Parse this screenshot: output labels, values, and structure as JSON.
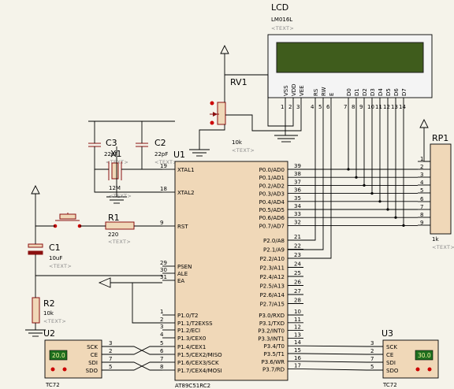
{
  "lcd": {
    "ref": "LCD",
    "model": "LM016L",
    "placeholder": "<TEXT>",
    "pins": [
      {
        "name": "VSS",
        "num": "1"
      },
      {
        "name": "VDD",
        "num": "2"
      },
      {
        "name": "VEE",
        "num": "3"
      },
      {
        "name": "RS",
        "num": "4"
      },
      {
        "name": "RW",
        "num": "5"
      },
      {
        "name": "E",
        "num": "6"
      },
      {
        "name": "D0",
        "num": "7"
      },
      {
        "name": "D1",
        "num": "8"
      },
      {
        "name": "D2",
        "num": "9"
      },
      {
        "name": "D3",
        "num": "10"
      },
      {
        "name": "D4",
        "num": "11"
      },
      {
        "name": "D5",
        "num": "12"
      },
      {
        "name": "D6",
        "num": "13"
      },
      {
        "name": "D7",
        "num": "14"
      }
    ],
    "screen_color": "#3f5c1c"
  },
  "rv1": {
    "ref": "RV1",
    "value": "10k",
    "placeholder": "<TEXT>"
  },
  "c3": {
    "ref": "C3",
    "value": "22pF",
    "placeholder": "<TEXT>"
  },
  "c2": {
    "ref": "C2",
    "value": "22pF",
    "placeholder": "<TEXT>"
  },
  "x1": {
    "ref": "X1",
    "value": "12M",
    "placeholder": "<TEXT>"
  },
  "r1": {
    "ref": "R1",
    "value": "220",
    "placeholder": "<TEXT>"
  },
  "c1": {
    "ref": "C1",
    "value": "10uF",
    "placeholder": "<TEXT>"
  },
  "r2": {
    "ref": "R2",
    "value": "10k",
    "placeholder": "<TEXT>"
  },
  "rp1": {
    "ref": "RP1",
    "value": "1k",
    "placeholder": "<TEXT>",
    "pins": [
      "1",
      "2",
      "3",
      "4",
      "5",
      "6",
      "7",
      "8",
      "9"
    ]
  },
  "u1": {
    "ref": "U1",
    "model": "AT89C51RC2",
    "left_pins": [
      {
        "name": "XTAL1",
        "num": "19"
      },
      {
        "name": "XTAL2",
        "num": "18"
      },
      {
        "name": "RST",
        "num": "9"
      },
      {
        "name": "PSEN",
        "num": "29"
      },
      {
        "name": "ALE",
        "num": "30"
      },
      {
        "name": "EA",
        "num": "31"
      },
      {
        "name": "P1.0/T2",
        "num": "1"
      },
      {
        "name": "P1.1/T2EXSS",
        "num": "2"
      },
      {
        "name": "P1.2/ECI",
        "num": "3"
      },
      {
        "name": "P1.3/CEX0",
        "num": "4"
      },
      {
        "name": "P1.4/CEX1",
        "num": "5"
      },
      {
        "name": "P1.5/CEX2/MISO",
        "num": "6"
      },
      {
        "name": "P1.6/CEX3/SCK",
        "num": "7"
      },
      {
        "name": "P1.7/CEX4/MOSI",
        "num": "8"
      }
    ],
    "right_pins": [
      {
        "name": "P0.0/AD0",
        "num": "39"
      },
      {
        "name": "P0.1/AD1",
        "num": "38"
      },
      {
        "name": "P0.2/AD2",
        "num": "37"
      },
      {
        "name": "P0.3/AD3",
        "num": "36"
      },
      {
        "name": "P0.4/AD4",
        "num": "35"
      },
      {
        "name": "P0.5/AD5",
        "num": "34"
      },
      {
        "name": "P0.6/AD6",
        "num": "33"
      },
      {
        "name": "P0.7/AD7",
        "num": "32"
      },
      {
        "name": "P2.0/A8",
        "num": "21"
      },
      {
        "name": "P2.1/A9",
        "num": "22"
      },
      {
        "name": "P2.2/A10",
        "num": "23"
      },
      {
        "name": "P2.3/A11",
        "num": "24"
      },
      {
        "name": "P2.4/A12",
        "num": "25"
      },
      {
        "name": "P2.5/A13",
        "num": "26"
      },
      {
        "name": "P2.6/A14",
        "num": "27"
      },
      {
        "name": "P2.7/A15",
        "num": "28"
      },
      {
        "name": "P3.0/RXD",
        "num": "10"
      },
      {
        "name": "P3.1/TXD",
        "num": "11"
      },
      {
        "name": "P3.2/INT0",
        "num": "12"
      },
      {
        "name": "P3.3/INT1",
        "num": "13"
      },
      {
        "name": "P3.4/T0",
        "num": "14"
      },
      {
        "name": "P3.5/T1",
        "num": "15"
      },
      {
        "name": "P3.6/WR",
        "num": "16"
      },
      {
        "name": "P3.7/RD",
        "num": "17"
      }
    ]
  },
  "u2": {
    "ref": "U2",
    "model": "TC72",
    "display": "20.0",
    "pins": [
      {
        "name": "SCK",
        "num": "3"
      },
      {
        "name": "CE",
        "num": "2"
      },
      {
        "name": "SDI",
        "num": "7"
      },
      {
        "name": "SDO",
        "num": "5"
      }
    ]
  },
  "u3": {
    "ref": "U3",
    "model": "TC72",
    "display": "30.0",
    "pins": [
      {
        "name": "SCK",
        "num": "3"
      },
      {
        "name": "CE",
        "num": "2"
      },
      {
        "name": "SDI",
        "num": "7"
      },
      {
        "name": "SDO",
        "num": "5"
      }
    ]
  },
  "colors": {
    "component": "#8b1010",
    "chip_fill": "#f0d8b8",
    "lcd_body": "#f4f4f4",
    "display_bg": "#1f6f1f",
    "display_text": "#f2f2a0"
  }
}
